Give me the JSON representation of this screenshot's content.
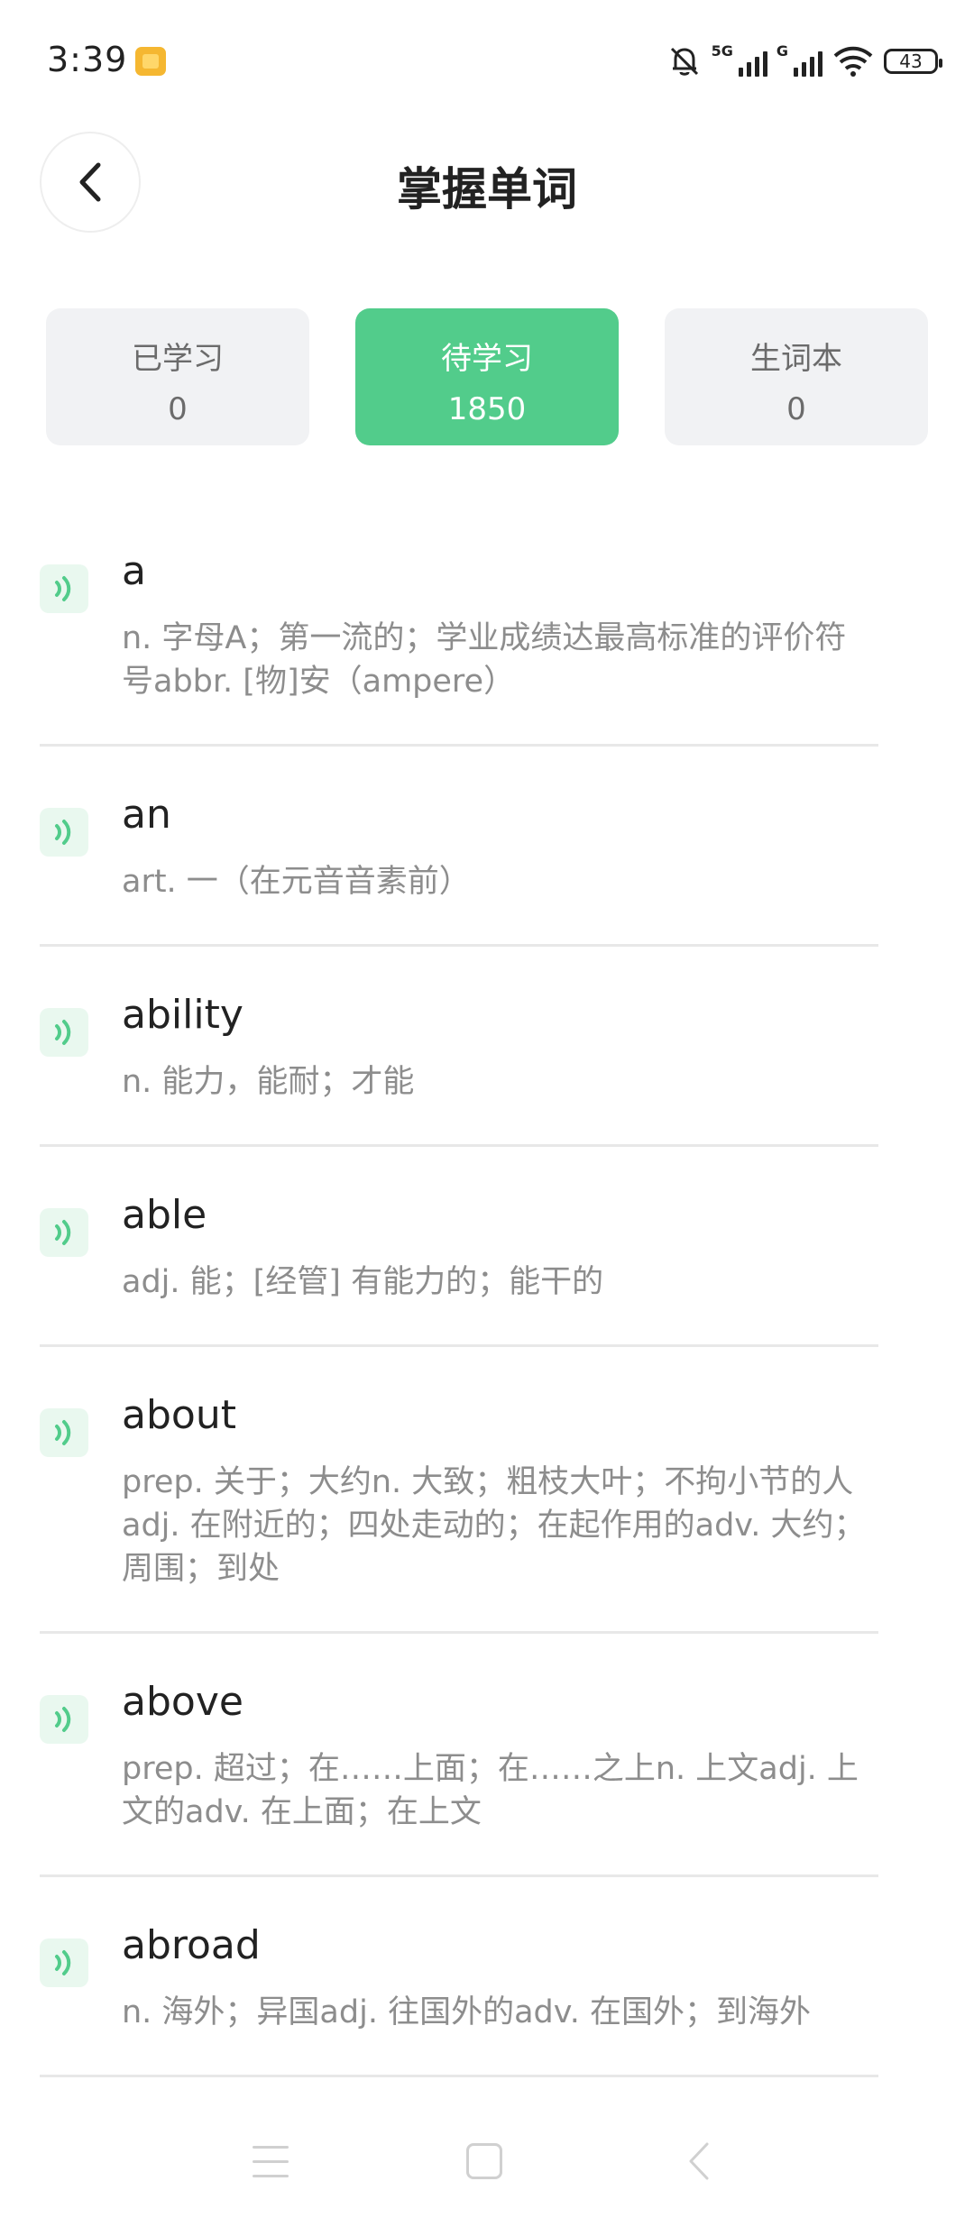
{
  "status_bar": {
    "time": "3:39",
    "network_1": "5G",
    "network_2": "G",
    "battery": "43"
  },
  "header": {
    "title": "掌握单词"
  },
  "tabs": [
    {
      "label": "已学习",
      "count": "0",
      "active": false
    },
    {
      "label": "待学习",
      "count": "1850",
      "active": true
    },
    {
      "label": "生词本",
      "count": "0",
      "active": false
    }
  ],
  "words": [
    {
      "word": "a",
      "meaning": "n. 字母A；第一流的；学业成绩达最高标准的评价符\n号abbr. [物]安（ampere）"
    },
    {
      "word": "an",
      "meaning": "art. 一（在元音音素前）"
    },
    {
      "word": "ability",
      "meaning": "n. 能力，能耐；才能"
    },
    {
      "word": "able",
      "meaning": "adj. 能；[经管] 有能力的；能干的"
    },
    {
      "word": "about",
      "meaning": "prep. 关于；大约n. 大致；粗枝大叶；不拘小节的人\nadj. 在附近的；四处走动的；在起作用的adv. 大约；\n周围；到处"
    },
    {
      "word": "above",
      "meaning": "prep. 超过；在……上面；在……之上n. 上文adj. 上\n文的adv. 在上面；在上文"
    },
    {
      "word": "abroad",
      "meaning": "n. 海外；异国adj. 往国外的adv. 在国外；到海外"
    }
  ],
  "colors": {
    "accent": "#52cc8b",
    "tab_bg": "#f1f2f4",
    "meaning_text": "#8d8d8d"
  },
  "icons": {
    "back": "chevron-left-icon",
    "speaker": "sound-wave-icon",
    "mute": "bell-off-icon",
    "wifi": "wifi-icon"
  }
}
